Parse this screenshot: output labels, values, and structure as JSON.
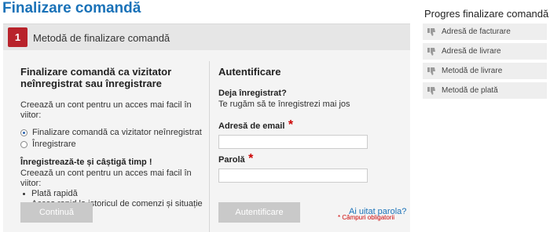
{
  "page": {
    "title": "Finalizare comandă"
  },
  "step": {
    "number": "1",
    "title": "Metodă de finalizare comandă"
  },
  "guest": {
    "heading": "Finalizare comandă ca vizitator neînregistrat sau înregistrare",
    "intro": "Creează un cont pentru un acces mai facil în viitor:",
    "options": [
      {
        "label": "Finalizare comandă ca vizitator neînregistrat",
        "checked": true
      },
      {
        "label": "Înregistrare",
        "checked": false
      }
    ],
    "promo_title": "Înregistrează-te și câștigă timp !",
    "promo_intro": "Creează un cont pentru un acces mai facil în viitor:",
    "benefits": [
      "Plată rapidă",
      "Acces rapid la istoricul de comenzi și situație"
    ],
    "continue_label": "Continuă"
  },
  "login": {
    "heading": "Autentificare",
    "already_registered": "Deja înregistrat?",
    "please_login": "Te rugăm să te înregistrezi mai jos",
    "email_label": "Adresă de email",
    "password_label": "Parolă",
    "required_star": "*",
    "email_value": "",
    "password_value": "",
    "required_note": "* Câmpuri obligatorii",
    "login_label": "Autentificare",
    "forgot_label": "Ai uitat parola?"
  },
  "sidebar": {
    "title": "Progres finalizare comandă",
    "items": [
      {
        "label": "Adresă de facturare",
        "icon": "thumb-down-icon"
      },
      {
        "label": "Adresă de livrare",
        "icon": "thumb-down-icon"
      },
      {
        "label": "Metodă de livrare",
        "icon": "thumb-down-icon"
      },
      {
        "label": "Metodă de plată",
        "icon": "thumb-down-icon"
      }
    ]
  },
  "colors": {
    "brand_blue": "#1a72b8",
    "step_red": "#b8232b",
    "required_red": "#cc0000",
    "button_gray": "#c9c9c9"
  }
}
